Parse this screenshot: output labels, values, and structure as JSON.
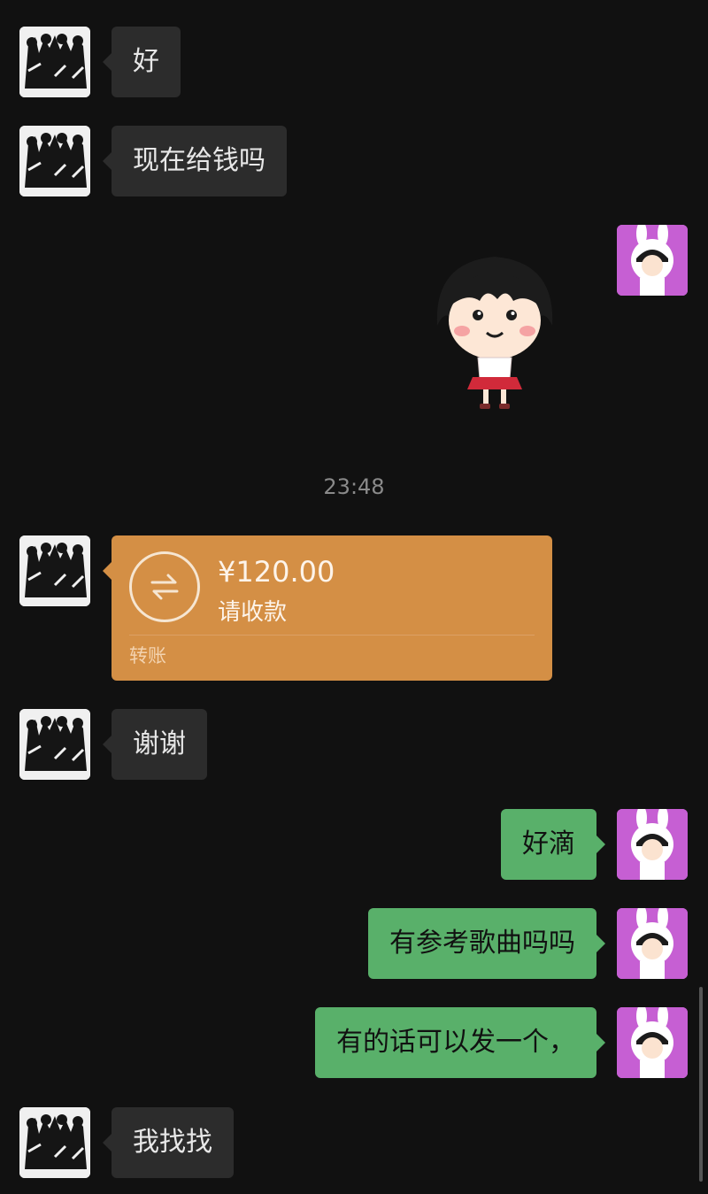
{
  "messages": [
    {
      "sender": "other",
      "text": "好"
    },
    {
      "sender": "other",
      "text": "现在给钱吗"
    },
    {
      "sender": "me",
      "type": "sticker",
      "sticker": "cartoon-girl-sticker"
    },
    {
      "type": "timestamp",
      "text": "23:48"
    },
    {
      "sender": "other",
      "type": "transfer",
      "amount": "¥120.00",
      "note": "请收款",
      "label": "转账"
    },
    {
      "sender": "other",
      "text": "谢谢"
    },
    {
      "sender": "me",
      "text": "好滴"
    },
    {
      "sender": "me",
      "text": "有参考歌曲吗吗"
    },
    {
      "sender": "me",
      "text": "有的话可以发一个，"
    },
    {
      "sender": "other",
      "text": "我找找"
    }
  ],
  "colors": {
    "background": "#111111",
    "incoming_bubble": "#2c2c2c",
    "outgoing_bubble": "#59b06a",
    "transfer_card": "#d48f45",
    "timestamp": "#8a8a8a"
  },
  "icons": {
    "other_avatar": "group-photo-avatar",
    "my_avatar": "bunny-hood-girl-avatar",
    "transfer": "transfer-arrows-icon"
  }
}
